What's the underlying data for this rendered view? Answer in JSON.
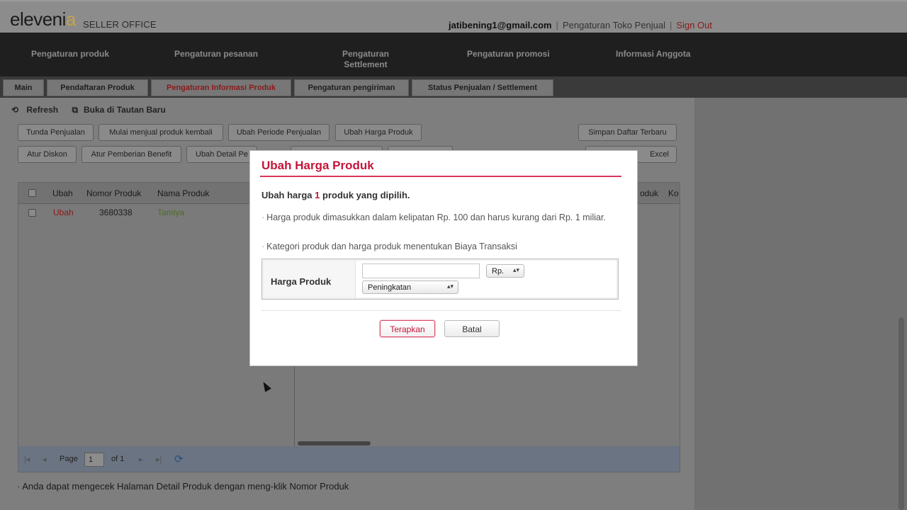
{
  "header": {
    "logo": "eleveni",
    "logo_tail": "a",
    "logo_sub": "SELLER OFFICE",
    "email": "jatibening1@gmail.com",
    "settings_link": "Pengaturan Toko Penjual",
    "signout": "Sign Out"
  },
  "main_nav": {
    "items": [
      {
        "label": "Pengaturan produk"
      },
      {
        "label": "Pengaturan pesanan"
      },
      {
        "label": "Pengaturan Settlement"
      },
      {
        "label": "Pengaturan promosi"
      },
      {
        "label": "Informasi Anggota"
      }
    ]
  },
  "sub_tabs": {
    "items": [
      {
        "label": "Main"
      },
      {
        "label": "Pendaftaran Produk"
      },
      {
        "label": "Pengaturan Informasi Produk",
        "active": true
      },
      {
        "label": "Pengaturan pengiriman"
      },
      {
        "label": "Status Penjualan / Settlement"
      }
    ]
  },
  "toolbar": {
    "refresh": "Refresh",
    "open_new": "Buka di Tautan Baru",
    "row1": [
      "Tunda Penjualan",
      "Mulai menjual produk kembali",
      "Ubah Periode Penjualan",
      "Ubah Harga Produk"
    ],
    "row2": [
      "Atur Diskon",
      "Atur Pemberian Benefit",
      "Ubah Detail Pe"
    ],
    "save_latest": "Simpan Daftar Terbaru",
    "excel": "Excel"
  },
  "grid": {
    "headers": [
      "Ubah",
      "Nomor Produk",
      "Nama Produk",
      "oduk",
      "Ko"
    ],
    "rows": [
      {
        "action": "Ubah",
        "number": "3680338",
        "name": "Tamiya"
      }
    ],
    "pager": {
      "page_label": "Page",
      "page_value": "1",
      "of_label": "of 1"
    }
  },
  "footnote": "Anda dapat mengecek Halaman Detail Produk dengan meng-klik Nomor Produk",
  "modal": {
    "title": "Ubah Harga Produk",
    "subtitle_pre": "Ubah harga",
    "subtitle_count": "1",
    "subtitle_post": "produk yang dipilih.",
    "notes": [
      "Harga produk dimasukkan dalam kelipatan Rp. 100 dan harus kurang dari Rp. 1 miliar.",
      "Kategori produk dan harga produk menentukan Biaya Transaksi"
    ],
    "field_label": "Harga Produk",
    "price_value": "",
    "currency": "Rp.",
    "mode": "Peningkatan",
    "apply": "Terapkan",
    "cancel": "Batal"
  },
  "colors": {
    "accent": "#c4153a",
    "nav_bg": "#1f1f1f",
    "overlay_gray": "#7e7e7e"
  }
}
